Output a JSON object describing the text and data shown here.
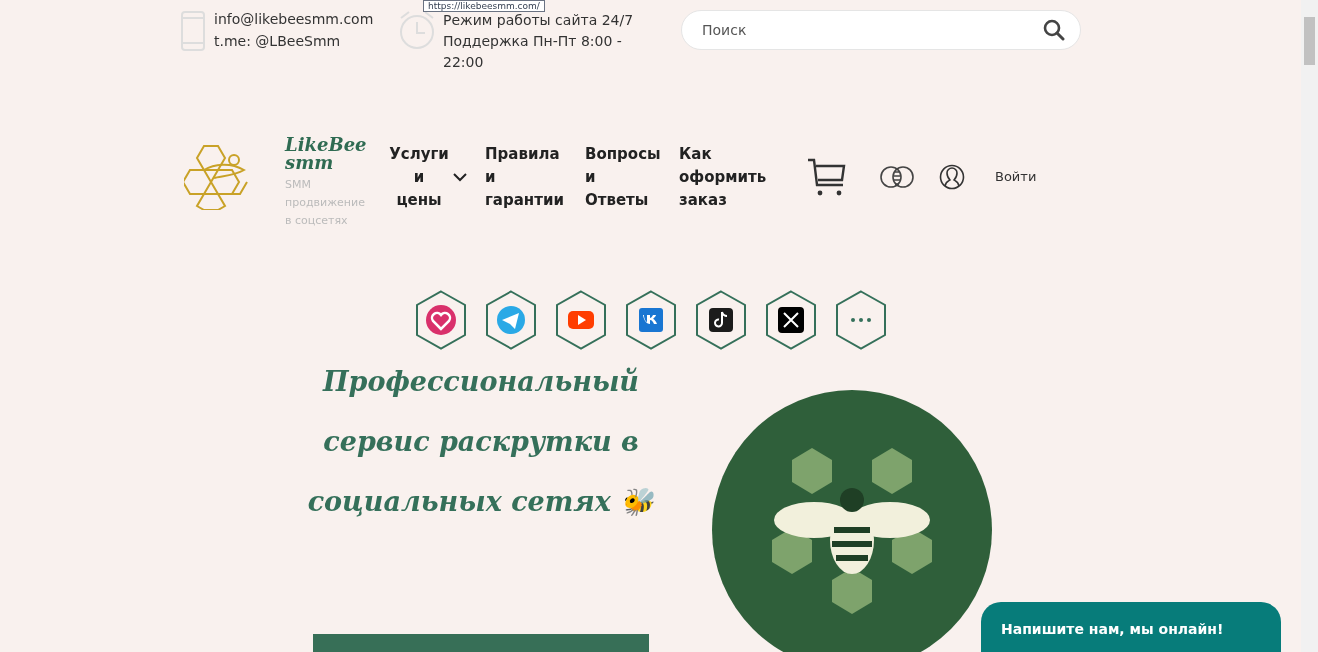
{
  "tooltip": "https://likebeesmm.com/",
  "contacts": {
    "email": "info@likebeesmm.com",
    "telegram": "t.me: @LBeeSmm"
  },
  "hours": {
    "line_1": "Режим работы сайта 24/7",
    "line_2": "Поддержка Пн-Пт 8:00 - 22:00"
  },
  "search": {
    "placeholder": "Поиск"
  },
  "logo": {
    "name": "LikeBee smm",
    "tagline": "SMM продвижение в соцсетях"
  },
  "nav": [
    {
      "label": "Услуги и цены",
      "dropdown": true
    },
    {
      "label": "Правила и гарантии",
      "dropdown": false
    },
    {
      "label": "Вопросы и Ответы",
      "dropdown": false
    },
    {
      "label": "Как оформить заказ",
      "dropdown": false
    }
  ],
  "login": "Войти",
  "hero": {
    "title": "Профессиональный сервис раскрутки в социальных сетях",
    "emoji": "🐝"
  },
  "chat": "Напишите нам, мы онлайн!"
}
